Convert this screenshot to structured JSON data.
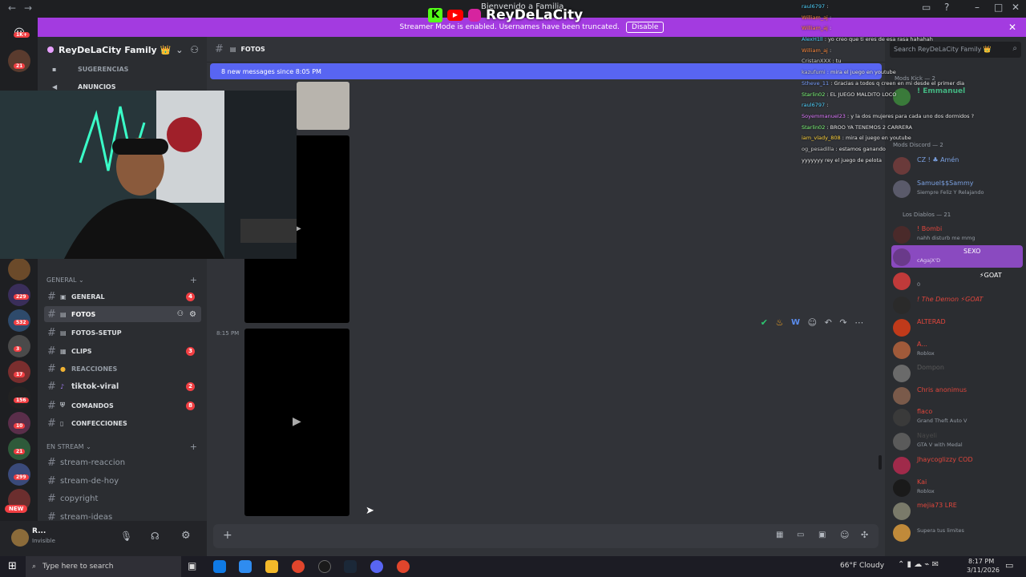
{
  "titlebar": {
    "back": "←",
    "forward": "→",
    "title_fragment": "Bienvenido a Familia"
  },
  "banner": {
    "text": "Streamer Mode is enabled. Usernames have been truncated.",
    "disable_label": "Disable"
  },
  "brand": {
    "name": "ReyDeLaCity"
  },
  "server_badges": [
    "1K+",
    "21",
    "229",
    "532",
    "3",
    "17",
    "156",
    "10",
    "21",
    "299",
    "NEW"
  ],
  "guild": {
    "name": "ReyDeLaCity Family 👑"
  },
  "top_channels": [
    {
      "label": "SUGERENCIAS"
    },
    {
      "label": "ANUNCIOS"
    }
  ],
  "categories": {
    "general": "GENERAL",
    "en_stream": "EN STREAM"
  },
  "channels": [
    {
      "label": "GENERAL",
      "badge": "4"
    },
    {
      "label": "FOTOS",
      "badge": ""
    },
    {
      "label": "FOTOS-SETUP",
      "badge": ""
    },
    {
      "label": "CLIPS",
      "badge": "3"
    },
    {
      "label": "REACCIONES",
      "badge": ""
    },
    {
      "label": "tiktok-viral",
      "badge": "2"
    },
    {
      "label": "COMANDOS",
      "badge": "8"
    },
    {
      "label": "CONFECCIONES",
      "badge": ""
    }
  ],
  "stream_channels": [
    "stream-reaccion",
    "stream-de-hoy",
    "copyright",
    "stream-ideas"
  ],
  "user": {
    "name": "R...",
    "status": "Invisible"
  },
  "chat": {
    "channel_name": "FOTOS",
    "new_messages": "8 new messages since 8:05 PM",
    "timestamp": "8:15 PM",
    "search_placeholder": "Search ReyDeLaCity Family 👑"
  },
  "overlay_chat": [
    {
      "user": "raul6797",
      "msg": ""
    },
    {
      "user": "William_aj",
      "msg": ""
    },
    {
      "user": "William_aj",
      "msg": ""
    },
    {
      "user": "AlexH1ll",
      "msg": "yo creo que ti eres de esa rasa hahahah"
    },
    {
      "user": "William_aj",
      "msg": ""
    },
    {
      "user": "CristanXXX",
      "msg": "tu"
    },
    {
      "user": "kazufumi",
      "msg": "mira el juego en youtube"
    },
    {
      "user": "Stheve_11",
      "msg": "Gracias a todos q creen en mi desde el primer dia"
    },
    {
      "user": "Starlin02",
      "msg": "EL JUEGO MALDITO LOCO"
    },
    {
      "user": "raul6797",
      "msg": ""
    },
    {
      "user": "Soyemmanuel23",
      "msg": "y la dos mujeres para cada uno dos dormidos ?"
    },
    {
      "user": "Starlin02",
      "msg": "BROO YA TENEMOS 2 CARRERA"
    },
    {
      "user": "iam_vlady_808",
      "msg": "mira el juego en youtube"
    },
    {
      "user": "og_pesadilla",
      "msg": "estamos ganando"
    },
    {
      "user": "",
      "msg": "yyyyyyy rey el juego de pelota"
    }
  ],
  "members": {
    "mods_kick": "Mods Kick — 2",
    "mods_discord": "Mods Discord — 2",
    "los_diablos": "Los Diablos — 21",
    "list_kick": [
      {
        "name": "! Emmanuel",
        "status": ""
      }
    ],
    "list_discord": [
      {
        "name": "CZ ! ♣ Amén",
        "status": ""
      },
      {
        "name": "Samuel$$Sammy",
        "status": "Siempre Feliz Y Relajando"
      }
    ],
    "list_diablos": [
      {
        "name": "! Bombi",
        "status": "nahh disturb me mmg"
      },
      {
        "name": "SEXO",
        "status": "cAgajX'D"
      },
      {
        "name": "⚡GOAT",
        "status": "0"
      },
      {
        "name": "! The Demon ⚡GOAT",
        "status": ""
      },
      {
        "name": "ALTERAD",
        "status": ""
      },
      {
        "name": "A...",
        "status": "Roblox"
      },
      {
        "name": "Dompon",
        "status": ""
      },
      {
        "name": "Chris anonimus",
        "status": ""
      },
      {
        "name": "flaco",
        "status": "Grand Theft Auto V"
      },
      {
        "name": "Nayeli",
        "status": "GTA V with Medal"
      },
      {
        "name": "Jhaycoglizzy COD",
        "status": ""
      },
      {
        "name": "Kai",
        "status": "Roblox"
      },
      {
        "name": "mejia73 LRE",
        "status": ""
      },
      {
        "name": "Supera tus limites",
        "status": "Supera tus limites"
      }
    ]
  },
  "taskbar": {
    "search_placeholder": "Type here to search",
    "weather": "66°F  Cloudy",
    "time": "8:17 PM",
    "date": "3/11/2026"
  },
  "colors": {
    "accent": "#5865f2",
    "banner": "#a33be0",
    "badge": "#f23f43"
  }
}
